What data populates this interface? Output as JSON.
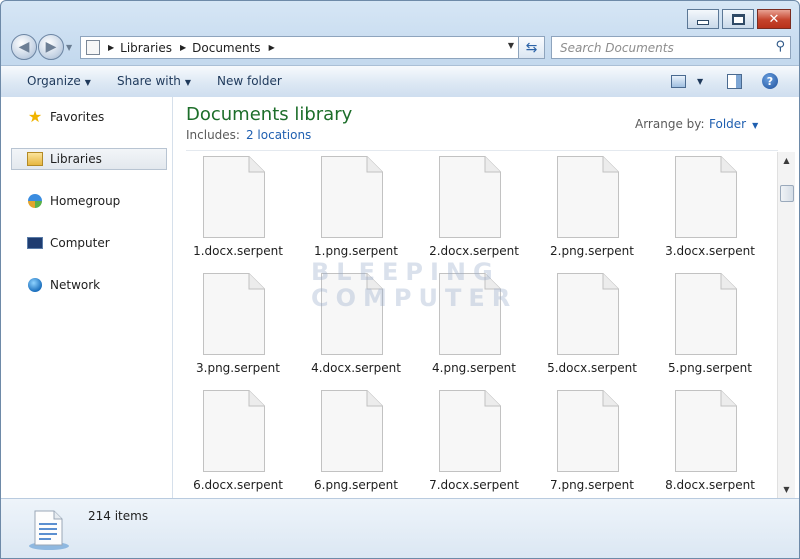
{
  "address": {
    "crumbs": [
      "Libraries",
      "Documents"
    ]
  },
  "search": {
    "placeholder": "Search Documents"
  },
  "toolbar": {
    "organize": "Organize",
    "share_with": "Share with",
    "new_folder": "New folder"
  },
  "navpane": {
    "items": [
      {
        "label": "Favorites",
        "icon": "star-icon"
      },
      {
        "label": "Libraries",
        "icon": "libraries-icon"
      },
      {
        "label": "Homegroup",
        "icon": "homegroup-icon"
      },
      {
        "label": "Computer",
        "icon": "computer-icon"
      },
      {
        "label": "Network",
        "icon": "network-icon"
      }
    ]
  },
  "content": {
    "title": "Documents library",
    "includes_label": "Includes:",
    "includes_link": "2 locations",
    "arrange_label": "Arrange by:",
    "arrange_value": "Folder"
  },
  "files": [
    "1.docx.serpent",
    "1.png.serpent",
    "2.docx.serpent",
    "2.png.serpent",
    "3.docx.serpent",
    "3.png.serpent",
    "4.docx.serpent",
    "4.png.serpent",
    "5.docx.serpent",
    "5.png.serpent",
    "6.docx.serpent",
    "6.png.serpent",
    "7.docx.serpent",
    "7.png.serpent",
    "8.docx.serpent"
  ],
  "watermark": [
    "BLEEPING",
    "COMPUTER"
  ],
  "details": {
    "count": "214 items"
  }
}
